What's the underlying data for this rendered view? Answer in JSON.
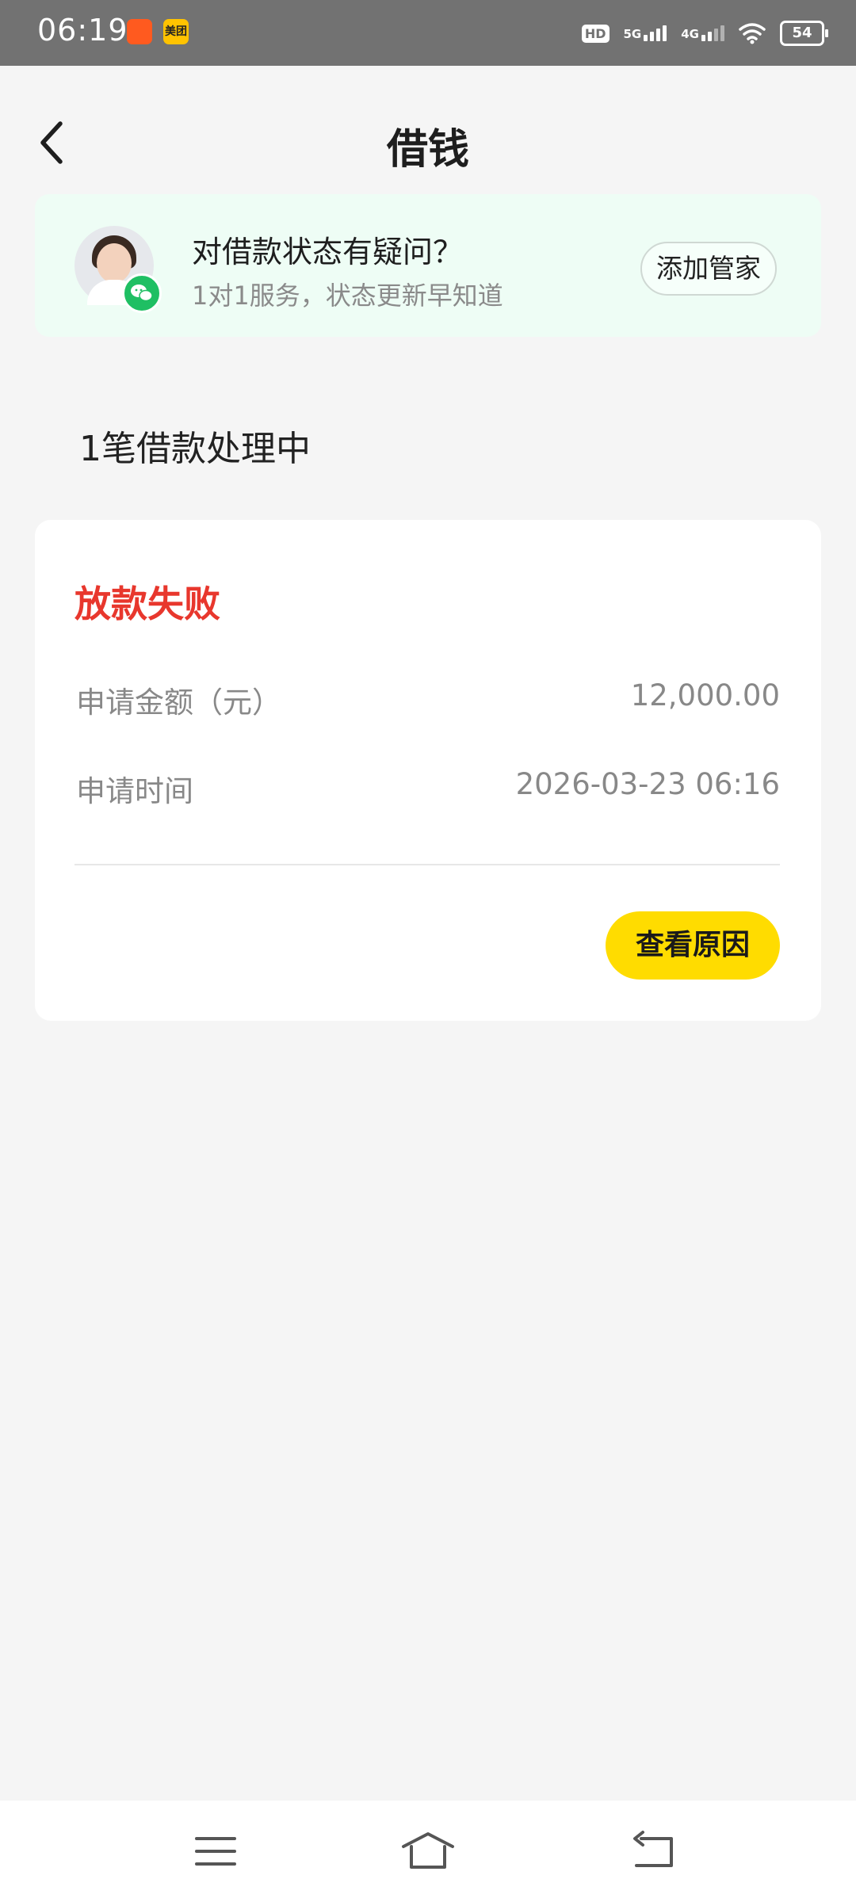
{
  "status_bar": {
    "time": "06:19",
    "hd": "HD",
    "network1": "5G",
    "network2": "4G",
    "battery": "54",
    "badge_meituan": "美团"
  },
  "header": {
    "title": "借钱"
  },
  "banner": {
    "title": "对借款状态有疑问？",
    "subtitle": "1对1服务，状态更新早知道",
    "button_label": "添加管家"
  },
  "section": {
    "heading": "1笔借款处理中"
  },
  "loan_card": {
    "status": "放款失败",
    "amount_label": "申请金额（元）",
    "amount_value": "12,000.00",
    "time_label": "申请时间",
    "time_value": "2026-03-23 06:16",
    "button_label": "查看原因"
  },
  "colors": {
    "accent_yellow": "#ffdc00",
    "fail_red": "#e8372d",
    "banner_bg": "#eefdf5"
  },
  "icons": [
    "back-arrow-icon",
    "wechat-icon",
    "menu-icon",
    "home-icon",
    "back-icon"
  ]
}
